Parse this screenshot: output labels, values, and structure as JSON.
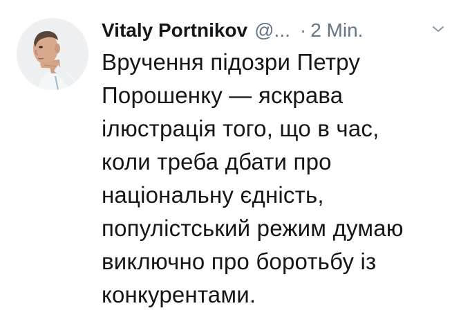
{
  "tweet": {
    "author": {
      "name": "Vitaly Portnikov",
      "handle": "@...",
      "avatar_icon": "profile-photo"
    },
    "separator": "·",
    "time": "2 Min.",
    "menu_icon": "chevron-down-icon",
    "text_lines": [
      "Вручення підозри Петру",
      "Порошенку — яскрава",
      "ілюстрація того, що в час,",
      "коли треба дбати про",
      "національну єдність,",
      "популістський режим думаю",
      "виключно про боротьбу із",
      "конкурентами."
    ]
  },
  "colors": {
    "text": "#14171a",
    "secondary": "#657786",
    "background": "#ffffff"
  }
}
